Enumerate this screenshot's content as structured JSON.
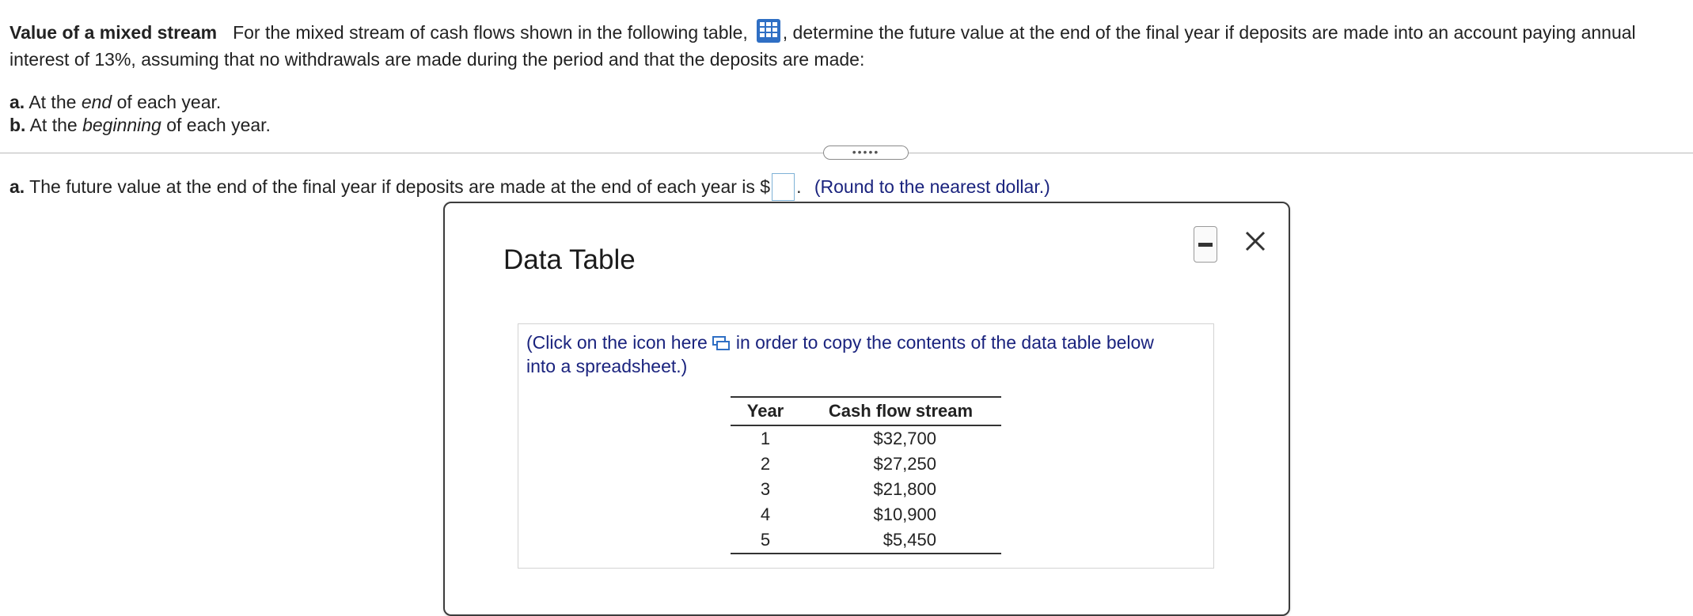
{
  "question": {
    "title": "Value of a mixed stream",
    "intro_1": "For the mixed stream of cash flows shown in the following table,",
    "intro_2": ", determine the future value at the end of the final year if deposits are made into an account paying annual",
    "intro_line2": "interest of 13%, assuming that no withdrawals are made during the period and that the deposits are made:",
    "part_a": {
      "label": "a.",
      "pre": "At the",
      "emph": "end",
      "post": "of each year."
    },
    "part_b": {
      "label": "b.",
      "pre": "At the",
      "emph": "beginning",
      "post": "of each year."
    }
  },
  "expander_label": "•••••",
  "answer": {
    "label": "a.",
    "text": "The future value at the end of the final year if deposits are made at the end of each year is $",
    "value": "",
    "suffix": ".",
    "hint": "(Round to the nearest dollar.)"
  },
  "modal": {
    "title": "Data Table",
    "copy_line1_pre": "(Click on the icon here",
    "copy_line1_post": "in order to copy the contents of the data table below",
    "copy_line2": "into a spreadsheet.)",
    "table": {
      "headers": [
        "Year",
        "Cash flow stream"
      ],
      "rows": [
        [
          "1",
          "$32,700"
        ],
        [
          "2",
          "$27,250"
        ],
        [
          "3",
          "$21,800"
        ],
        [
          "4",
          "$10,900"
        ],
        [
          "5",
          "$5,450"
        ]
      ]
    }
  },
  "icons": {
    "table": "table-grid-icon",
    "copy": "copy-to-spreadsheet-icon",
    "minimize": "minimize-icon",
    "close": "close-icon"
  },
  "colors": {
    "accent": "#1a237e",
    "icon_blue": "#2f6fc4",
    "input_border": "#7fb2d6"
  }
}
